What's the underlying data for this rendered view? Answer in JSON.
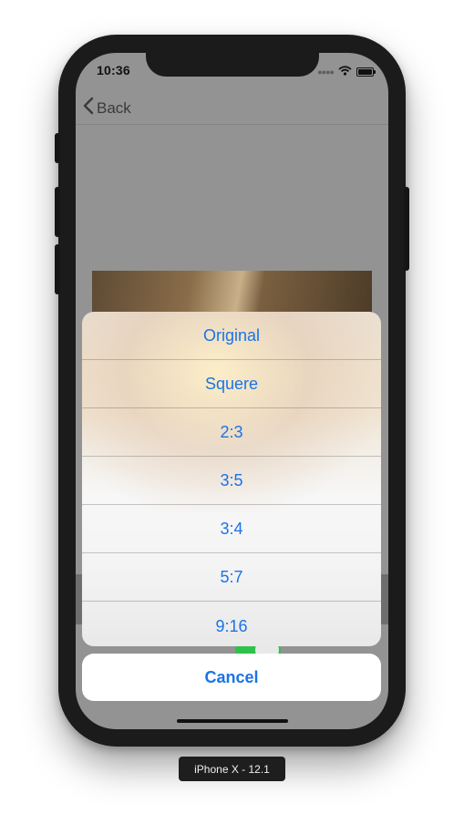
{
  "status_bar": {
    "time": "10:36",
    "signal_icon": "signal-dots-icon",
    "wifi_icon": "wifi-icon",
    "battery_icon": "battery-icon"
  },
  "navbar": {
    "back_label": "Back",
    "back_icon": "chevron-left-icon"
  },
  "action_sheet": {
    "options": [
      "Original",
      "Squere",
      "2:3",
      "3:5",
      "3:4",
      "5:7",
      "9:16"
    ],
    "cancel_label": "Cancel",
    "accent_color": "#1a73e8"
  },
  "device_label": "iPhone X - 12.1",
  "colors": {
    "overlay": "#939393",
    "toggle_on": "#2ec24a"
  }
}
